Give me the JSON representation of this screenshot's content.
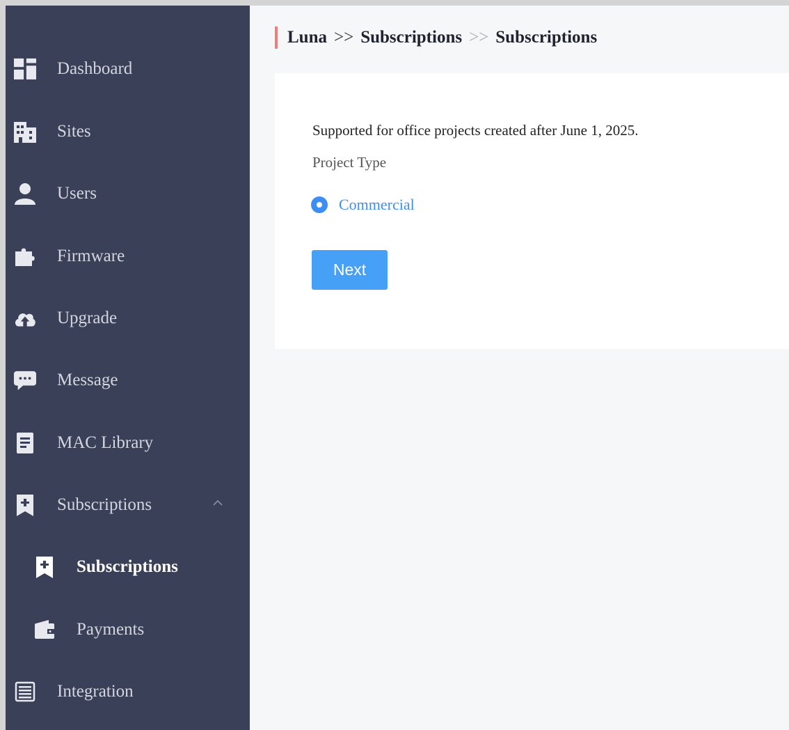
{
  "sidebar": {
    "items": [
      {
        "label": "Dashboard",
        "icon": "dashboard-icon"
      },
      {
        "label": "Sites",
        "icon": "building-icon"
      },
      {
        "label": "Users",
        "icon": "user-icon"
      },
      {
        "label": "Firmware",
        "icon": "puzzle-icon"
      },
      {
        "label": "Upgrade",
        "icon": "cloud-upload-icon"
      },
      {
        "label": "Message",
        "icon": "chat-icon"
      },
      {
        "label": "MAC Library",
        "icon": "document-icon"
      },
      {
        "label": "Subscriptions",
        "icon": "bookmark-plus-icon",
        "expanded": true
      },
      {
        "label": "Subscriptions",
        "icon": "bookmark-plus-icon",
        "active": true
      },
      {
        "label": "Payments",
        "icon": "wallet-icon"
      },
      {
        "label": "Integration",
        "icon": "list-icon"
      }
    ]
  },
  "breadcrumb": {
    "root": "Luna",
    "sep1": ">>",
    "section": "Subscriptions",
    "sep2": ">>",
    "page": "Subscriptions"
  },
  "content": {
    "notice": "Supported for office projects created after June 1, 2025.",
    "project_type_label": "Project Type",
    "radio_option": "Commercial",
    "next_button": "Next"
  },
  "colors": {
    "sidebar_bg": "#3b4059",
    "accent": "#3d8ef4",
    "breadcrumb_bar": "#f07c7c"
  }
}
